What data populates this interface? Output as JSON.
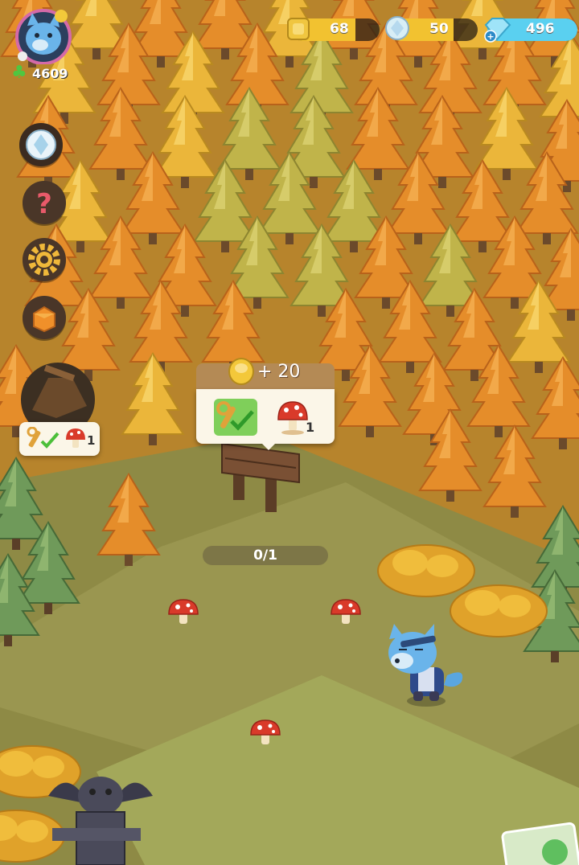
{
  "player": {
    "level_score": "4609",
    "avatar": "blue-wolf-avatar"
  },
  "resources": [
    {
      "name": "gold-token",
      "value": "68",
      "bar_color": "#f2c230",
      "fill": 0.55
    },
    {
      "name": "crystal-orb",
      "value": "50",
      "bar_color": "#f2c230",
      "fill": 0.55
    },
    {
      "name": "diamond",
      "value": "496",
      "bar_color": "#5ad0f0",
      "fill": 1.0
    }
  ],
  "side_buttons": [
    "quest-crystal-icon",
    "help-question-icon",
    "settings-gear-icon",
    "event-box-icon"
  ],
  "task_card": {
    "reward_text": "+ 20",
    "required_count": "1"
  },
  "mini_card": {
    "required_count": "1"
  },
  "progress": {
    "text": "0/1",
    "fraction": 0
  },
  "colors": {
    "forest_orange": "#e8962c",
    "forest_yellow": "#e9b83a",
    "forest_green": "#b7b248",
    "ground": "#8e8a45"
  }
}
